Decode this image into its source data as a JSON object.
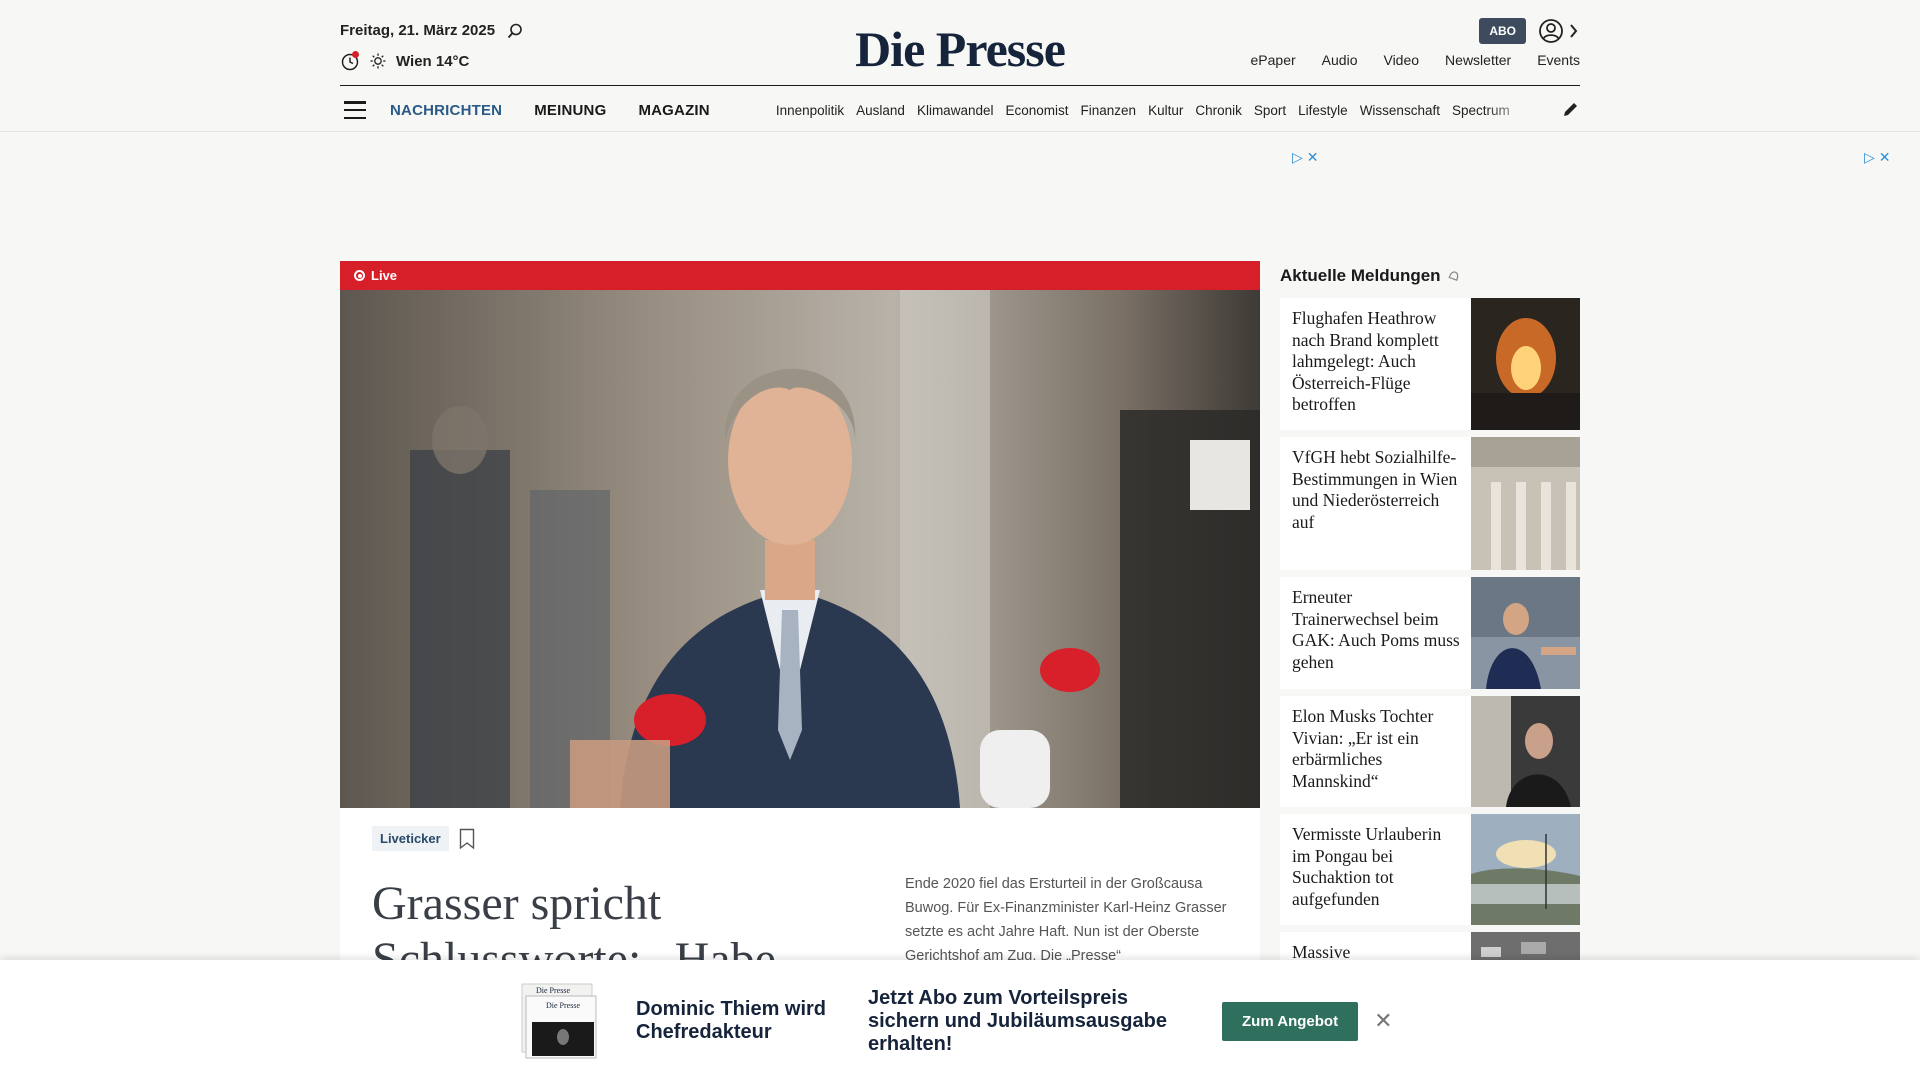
{
  "header": {
    "date": "Freitag, 21. März 2025",
    "weather": "Wien 14°C",
    "logo": "Die Presse",
    "abo": "ABO",
    "top_links": [
      "ePaper",
      "Audio",
      "Video",
      "Newsletter",
      "Events"
    ]
  },
  "nav": {
    "main": [
      "NACHRICHTEN",
      "MEINUNG",
      "MAGAZIN"
    ],
    "sub": [
      "Innenpolitik",
      "Ausland",
      "Klimawandel",
      "Economist",
      "Finanzen",
      "Kultur",
      "Chronik",
      "Sport",
      "Lifestyle",
      "Wissenschaft",
      "Spectrum"
    ]
  },
  "hero": {
    "live_label": "Live",
    "tag": "Liveticker",
    "headline": "Grasser spricht Schlussworte: „Habe",
    "teaser": "Ende 2020 fiel das Ersturteil in der Großcausa Buwog. Für Ex-Finanzminister Karl-Heinz Grasser setzte es acht Jahre Haft. Nun ist der Oberste Gerichtshof am Zug. Die „Presse“"
  },
  "sidebar": {
    "title": "Aktuelle Meldungen",
    "items": [
      {
        "title": "Flughafen Heathrow nach Brand komplett lahmgelegt: Auch Österreich-Flüge betroffen"
      },
      {
        "title": "VfGH hebt Sozialhilfe-Bestimmungen in Wien und Niederösterreich auf"
      },
      {
        "title": "Erneuter Trainerwechsel beim GAK: Auch Poms muss gehen"
      },
      {
        "title": "Elon Musks Tochter Vivian: „Er ist ein erbärmliches Mannskind“"
      },
      {
        "title": "Vermisste Urlauberin im Pongau bei Suchaktion tot aufgefunden"
      },
      {
        "title": "Massive"
      }
    ]
  },
  "banner": {
    "headline": "Dominic Thiem wird Chefredakteur",
    "offer": "Jetzt Abo zum Vorteilspreis sichern und Jubiläumsausgabe erhalten!",
    "button": "Zum Angebot"
  },
  "colors": {
    "live": "#d71f2a",
    "accent": "#2a5a87",
    "cta": "#2e6f5e",
    "logo": "#16243b"
  }
}
